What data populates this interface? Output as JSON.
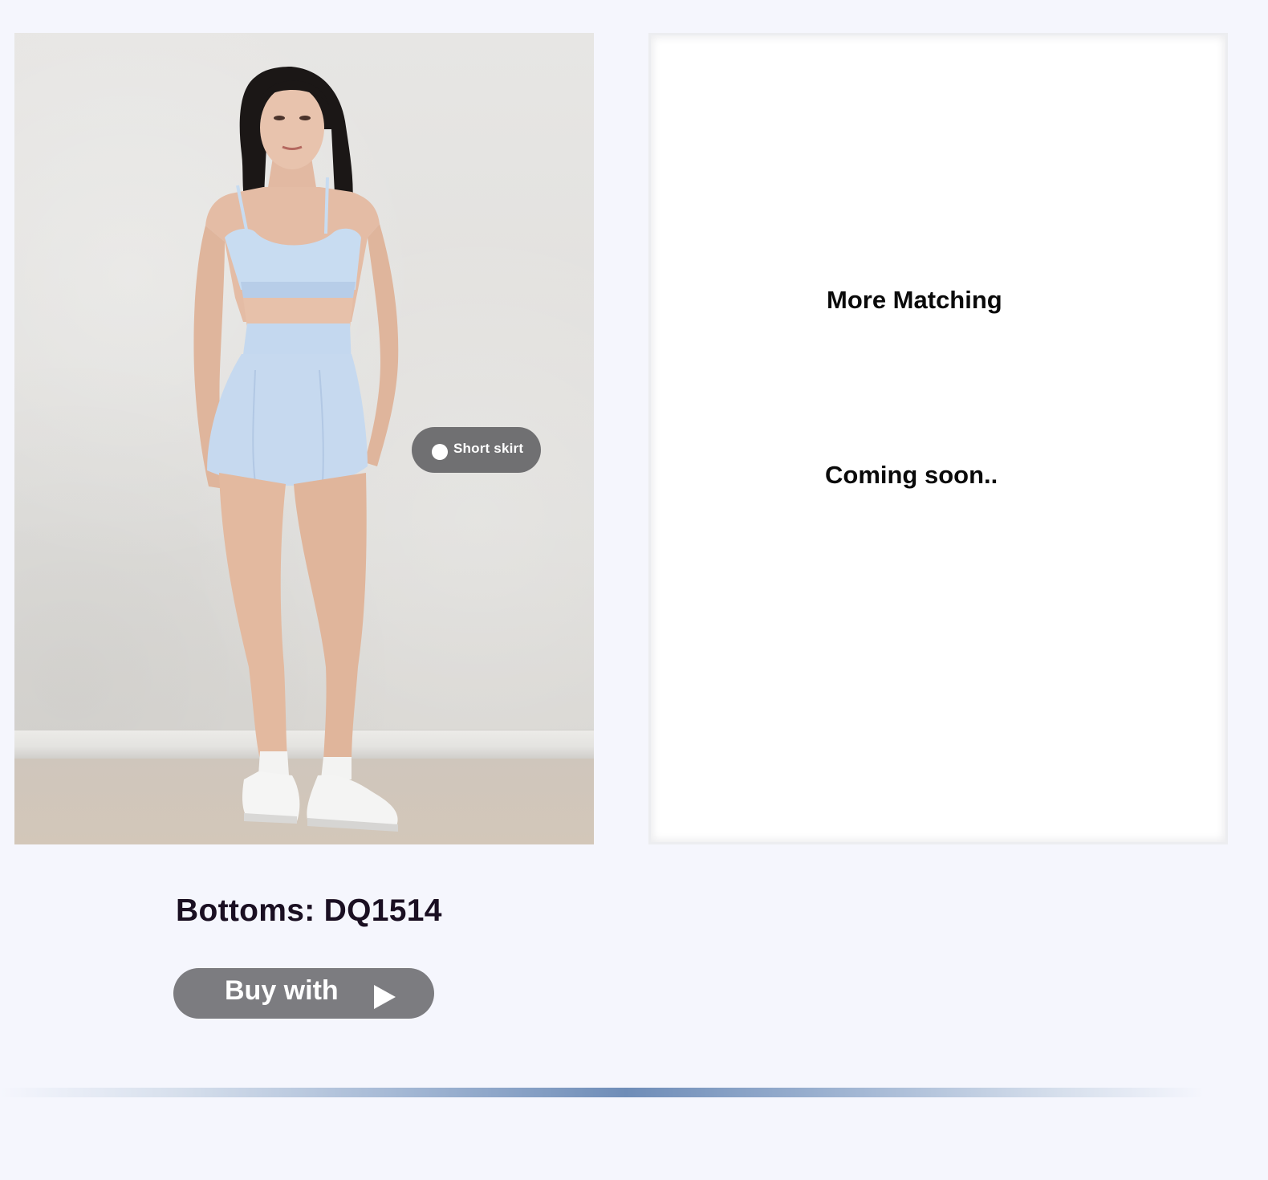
{
  "product_image": {
    "hotspot": {
      "label": "Short skirt"
    }
  },
  "matching": {
    "title": "More Matching",
    "status": "Coming soon.."
  },
  "product": {
    "code": "Bottoms: DQ1514",
    "buy_label": "Buy with",
    "buy_icon": "play-icon"
  },
  "colors": {
    "page_background": "#f5f6fd",
    "button_background": "#7c7c80",
    "hotspot_background": "#606062",
    "divider_accent": "#6f8db8",
    "product_color": "#c6d9ef"
  }
}
